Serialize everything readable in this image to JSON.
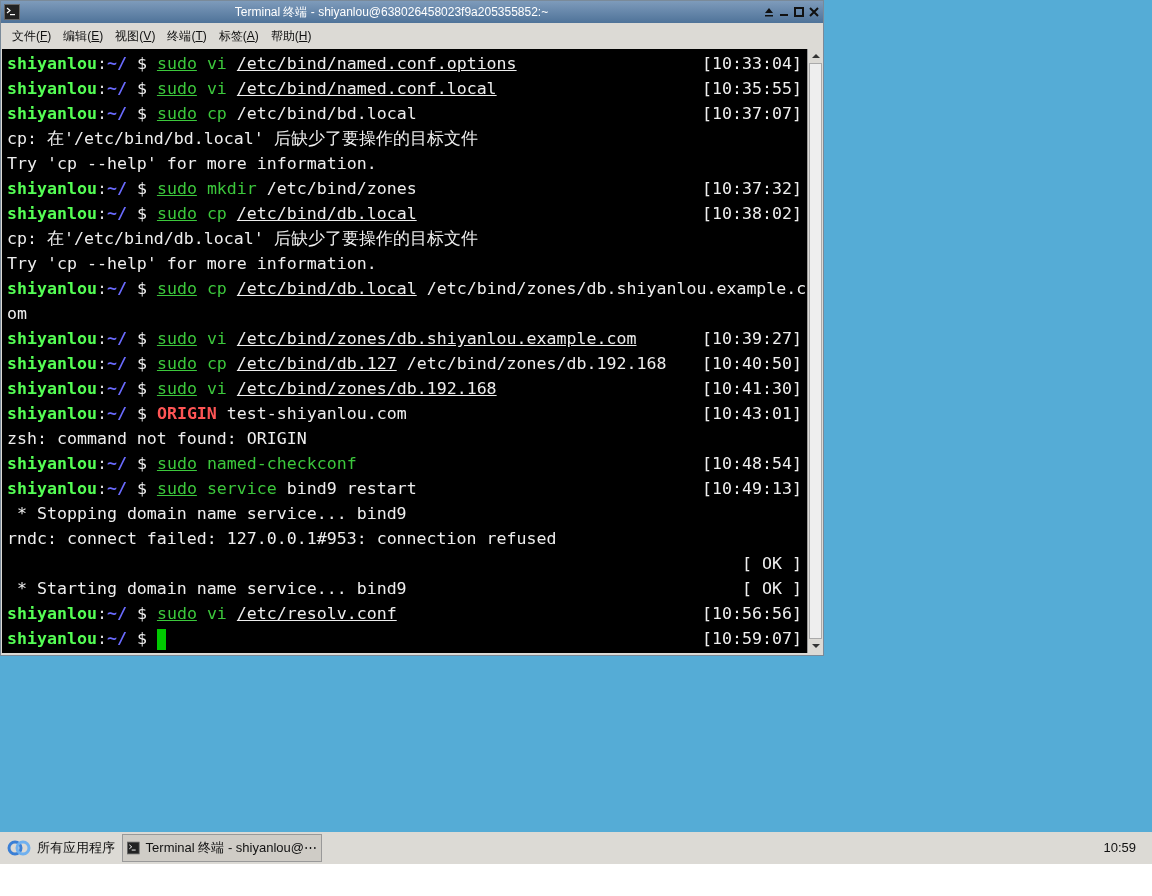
{
  "window": {
    "title": "Terminal 终端 - shiyanlou@638026458023f9a205355852:~"
  },
  "menu": [
    "文件(F)",
    "编辑(E)",
    "视图(V)",
    "终端(T)",
    "标签(A)",
    "帮助(H)"
  ],
  "terminal": {
    "lines": [
      {
        "kind": "prompt",
        "user": "shiyanlou",
        "sep": ":",
        "dir": "~/",
        "symbol": "$",
        "tokens": [
          {
            "kind": "sudo",
            "text": "sudo"
          },
          {
            "kind": "command",
            "text": "vi"
          },
          {
            "kind": "file",
            "text": "/etc/bind/named.conf.options"
          }
        ],
        "time": "[10:33:04]"
      },
      {
        "kind": "prompt",
        "user": "shiyanlou",
        "sep": ":",
        "dir": "~/",
        "symbol": "$",
        "tokens": [
          {
            "kind": "sudo",
            "text": "sudo"
          },
          {
            "kind": "command",
            "text": "vi"
          },
          {
            "kind": "file",
            "text": "/etc/bind/named.conf.local"
          }
        ],
        "time": "[10:35:55]"
      },
      {
        "kind": "prompt",
        "user": "shiyanlou",
        "sep": ":",
        "dir": "~/",
        "symbol": "$",
        "tokens": [
          {
            "kind": "sudo",
            "text": "sudo"
          },
          {
            "kind": "command",
            "text": "cp"
          },
          {
            "kind": "plain",
            "text": "/etc/bind/bd.local"
          }
        ],
        "time": "[10:37:07]"
      },
      {
        "kind": "output",
        "text": "cp: 在'/etc/bind/bd.local' 后缺少了要操作的目标文件"
      },
      {
        "kind": "output",
        "text": "Try 'cp --help' for more information."
      },
      {
        "kind": "prompt",
        "user": "shiyanlou",
        "sep": ":",
        "dir": "~/",
        "symbol": "$",
        "tokens": [
          {
            "kind": "sudo",
            "text": "sudo"
          },
          {
            "kind": "command",
            "text": "mkdir"
          },
          {
            "kind": "plain",
            "text": "/etc/bind/zones"
          }
        ],
        "time": "[10:37:32]"
      },
      {
        "kind": "prompt",
        "user": "shiyanlou",
        "sep": ":",
        "dir": "~/",
        "symbol": "$",
        "tokens": [
          {
            "kind": "sudo",
            "text": "sudo"
          },
          {
            "kind": "command",
            "text": "cp"
          },
          {
            "kind": "file",
            "text": "/etc/bind/db.local"
          }
        ],
        "time": "[10:38:02]"
      },
      {
        "kind": "output",
        "text": "cp: 在'/etc/bind/db.local' 后缺少了要操作的目标文件"
      },
      {
        "kind": "output",
        "text": "Try 'cp --help' for more information."
      },
      {
        "kind": "prompt",
        "user": "shiyanlou",
        "sep": ":",
        "dir": "~/",
        "symbol": "$",
        "tokens": [
          {
            "kind": "sudo",
            "text": "sudo"
          },
          {
            "kind": "command",
            "text": "cp"
          },
          {
            "kind": "file",
            "text": "/etc/bind/db.local"
          },
          {
            "kind": "plain",
            "text": "/etc/bind/zones/db.shiyanlou.example.c"
          }
        ]
      },
      {
        "kind": "output",
        "text": "om"
      },
      {
        "kind": "prompt",
        "user": "shiyanlou",
        "sep": ":",
        "dir": "~/",
        "symbol": "$",
        "tokens": [
          {
            "kind": "sudo",
            "text": "sudo"
          },
          {
            "kind": "command",
            "text": "vi"
          },
          {
            "kind": "file",
            "text": "/etc/bind/zones/db.shiyanlou.example.com"
          }
        ],
        "time": "[10:39:27]"
      },
      {
        "kind": "prompt",
        "user": "shiyanlou",
        "sep": ":",
        "dir": "~/",
        "symbol": "$",
        "tokens": [
          {
            "kind": "sudo",
            "text": "sudo"
          },
          {
            "kind": "command",
            "text": "cp"
          },
          {
            "kind": "file",
            "text": "/etc/bind/db.127"
          },
          {
            "kind": "plain",
            "text": "/etc/bind/zones/db.192.168"
          }
        ],
        "time": "[10:40:50]"
      },
      {
        "kind": "prompt",
        "user": "shiyanlou",
        "sep": ":",
        "dir": "~/",
        "symbol": "$",
        "tokens": [
          {
            "kind": "sudo",
            "text": "sudo"
          },
          {
            "kind": "command",
            "text": "vi"
          },
          {
            "kind": "file",
            "text": "/etc/bind/zones/db.192.168"
          }
        ],
        "time": "[10:41:30]"
      },
      {
        "kind": "prompt",
        "user": "shiyanlou",
        "sep": ":",
        "dir": "~/",
        "symbol": "$",
        "tokens": [
          {
            "kind": "unknown",
            "text": "ORIGIN"
          },
          {
            "kind": "plain",
            "text": "test-shiyanlou.com"
          }
        ],
        "time": "[10:43:01]"
      },
      {
        "kind": "output",
        "text": "zsh: command not found: ORIGIN"
      },
      {
        "kind": "prompt",
        "user": "shiyanlou",
        "sep": ":",
        "dir": "~/",
        "symbol": "$",
        "tokens": [
          {
            "kind": "sudo",
            "text": "sudo"
          },
          {
            "kind": "command",
            "text": "named-checkconf"
          }
        ],
        "time": "[10:48:54]"
      },
      {
        "kind": "prompt",
        "user": "shiyanlou",
        "sep": ":",
        "dir": "~/",
        "symbol": "$",
        "tokens": [
          {
            "kind": "sudo",
            "text": "sudo"
          },
          {
            "kind": "command",
            "text": "service"
          },
          {
            "kind": "plain",
            "text": "bind9 restart"
          }
        ],
        "time": "[10:49:13]"
      },
      {
        "kind": "output",
        "text": " * Stopping domain name service... bind9"
      },
      {
        "kind": "output",
        "text": "rndc: connect failed: 127.0.0.1#953: connection refused"
      },
      {
        "kind": "output",
        "status": "[ OK ]"
      },
      {
        "kind": "output",
        "text": " * Starting domain name service... bind9",
        "status": "[ OK ]"
      },
      {
        "kind": "prompt",
        "user": "shiyanlou",
        "sep": ":",
        "dir": "~/",
        "symbol": "$",
        "tokens": [
          {
            "kind": "sudo",
            "text": "sudo"
          },
          {
            "kind": "command",
            "text": "vi"
          },
          {
            "kind": "file",
            "text": "/etc/resolv.conf"
          }
        ],
        "time": "[10:56:56]"
      },
      {
        "kind": "prompt",
        "user": "shiyanlou",
        "sep": ":",
        "dir": "~/",
        "symbol": "$",
        "tokens": [
          {
            "kind": "cursor"
          }
        ],
        "time": "[10:59:07]"
      }
    ]
  },
  "taskbar": {
    "apps_menu": "所有应用程序",
    "tasks": [
      {
        "label": "Terminal 终端 - shiyanlou@⋯",
        "selected": true
      }
    ],
    "clock": "10:59"
  }
}
